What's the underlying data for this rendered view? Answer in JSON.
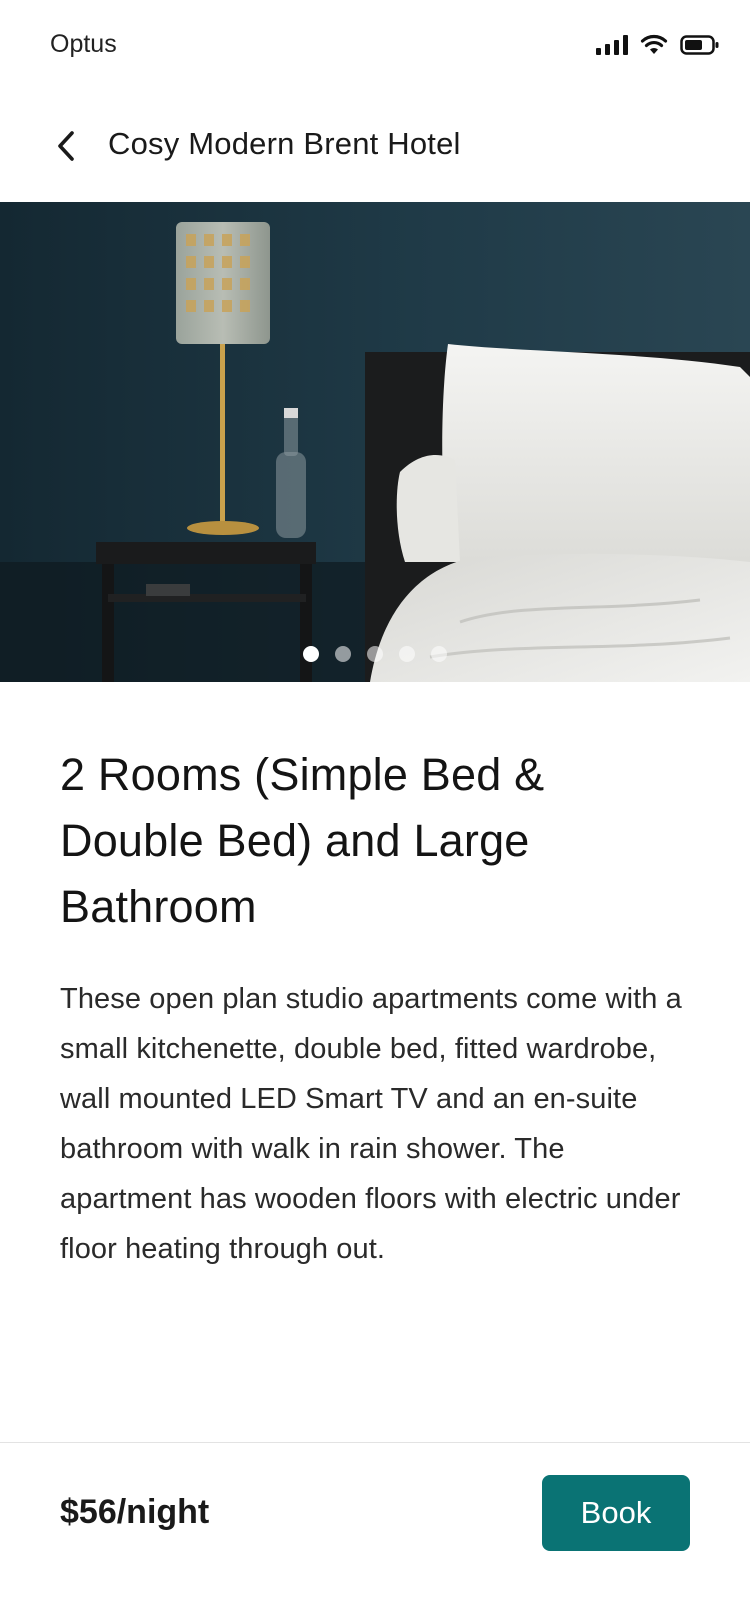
{
  "status_bar": {
    "carrier": "Optus",
    "icons": [
      "signal-icon",
      "wifi-icon",
      "battery-icon"
    ]
  },
  "header": {
    "back_icon": "chevron-left-icon",
    "title": "Cosy Modern Brent Hotel"
  },
  "gallery": {
    "image_alt": "hotel-bedroom-photo",
    "slide_count": 5,
    "active_index": 0
  },
  "room": {
    "title": "2 Rooms (Simple Bed & Double Bed) and Large Bathroom",
    "description": "These open plan studio apartments come with a small kitchenette, double bed, fitted wardrobe, wall mounted LED Smart TV and an en-suite bathroom with walk in rain shower. The apartment has wooden floors with electric under floor heating through out."
  },
  "footer": {
    "price": "$56/night",
    "book_label": "Book"
  },
  "colors": {
    "accent": "#0a7374",
    "wall": "#1d3440",
    "text": "#1a1a1a"
  }
}
